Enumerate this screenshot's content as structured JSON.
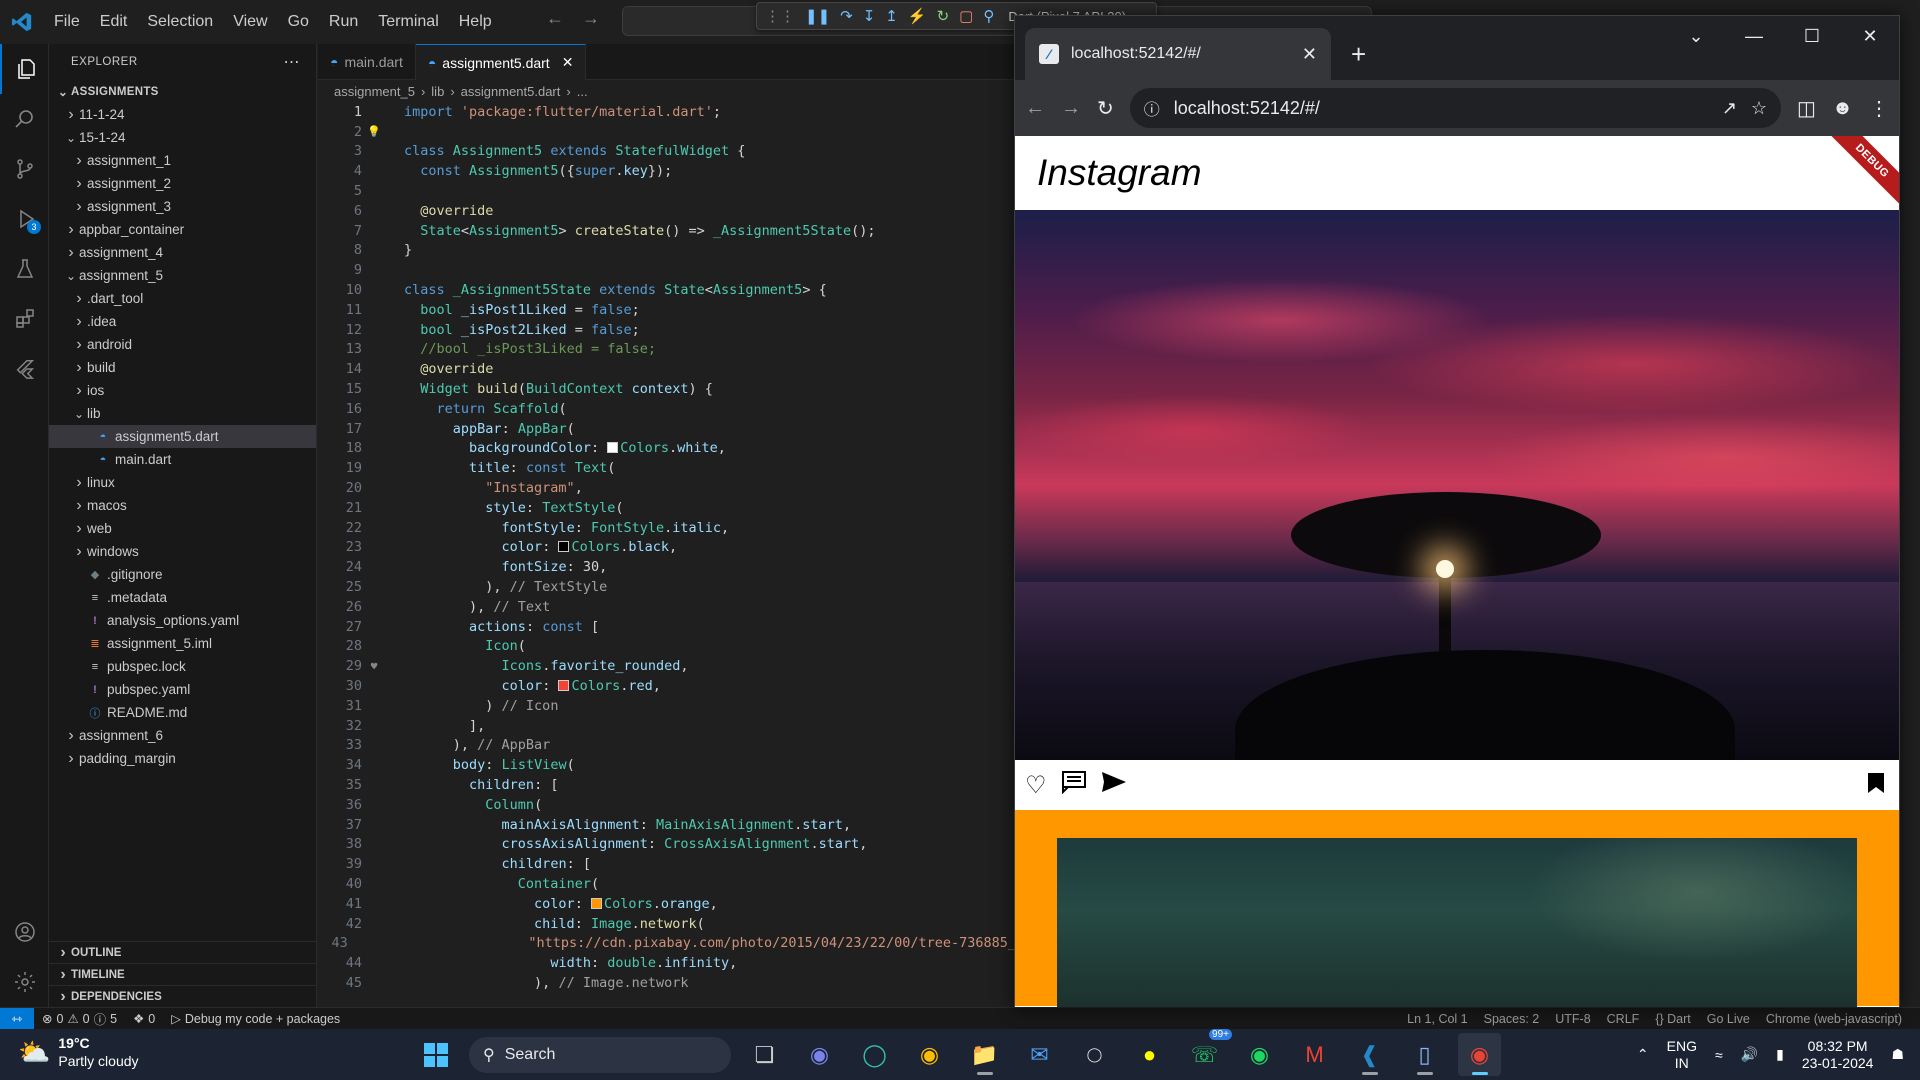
{
  "titlebar": {
    "menu": [
      "File",
      "Edit",
      "Selection",
      "View",
      "Go",
      "Run",
      "Terminal",
      "Help"
    ],
    "debug_target": "Dart (Pixel 7 API 30)"
  },
  "explorer": {
    "header": "EXPLORER",
    "root": "ASSIGNMENTS",
    "items": [
      {
        "label": "11-1-24",
        "indent": 1,
        "kind": "folder-closed"
      },
      {
        "label": "15-1-24",
        "indent": 1,
        "kind": "folder-open"
      },
      {
        "label": "assignment_1",
        "indent": 2,
        "kind": "folder-closed"
      },
      {
        "label": "assignment_2",
        "indent": 2,
        "kind": "folder-closed"
      },
      {
        "label": "assignment_3",
        "indent": 2,
        "kind": "folder-closed"
      },
      {
        "label": "appbar_container",
        "indent": 1,
        "kind": "folder-closed"
      },
      {
        "label": "assignment_4",
        "indent": 1,
        "kind": "folder-closed"
      },
      {
        "label": "assignment_5",
        "indent": 1,
        "kind": "folder-open"
      },
      {
        "label": ".dart_tool",
        "indent": 2,
        "kind": "folder-closed"
      },
      {
        "label": ".idea",
        "indent": 2,
        "kind": "folder-closed"
      },
      {
        "label": "android",
        "indent": 2,
        "kind": "folder-closed"
      },
      {
        "label": "build",
        "indent": 2,
        "kind": "folder-closed"
      },
      {
        "label": "ios",
        "indent": 2,
        "kind": "folder-closed"
      },
      {
        "label": "lib",
        "indent": 2,
        "kind": "folder-open"
      },
      {
        "label": "assignment5.dart",
        "indent": 3,
        "kind": "dart",
        "selected": true
      },
      {
        "label": "main.dart",
        "indent": 3,
        "kind": "dart"
      },
      {
        "label": "linux",
        "indent": 2,
        "kind": "folder-closed"
      },
      {
        "label": "macos",
        "indent": 2,
        "kind": "folder-closed"
      },
      {
        "label": "web",
        "indent": 2,
        "kind": "folder-closed"
      },
      {
        "label": "windows",
        "indent": 2,
        "kind": "folder-closed"
      },
      {
        "label": ".gitignore",
        "indent": 2,
        "kind": "git"
      },
      {
        "label": ".metadata",
        "indent": 2,
        "kind": "meta"
      },
      {
        "label": "analysis_options.yaml",
        "indent": 2,
        "kind": "yaml"
      },
      {
        "label": "assignment_5.iml",
        "indent": 2,
        "kind": "xml"
      },
      {
        "label": "pubspec.lock",
        "indent": 2,
        "kind": "meta"
      },
      {
        "label": "pubspec.yaml",
        "indent": 2,
        "kind": "yaml"
      },
      {
        "label": "README.md",
        "indent": 2,
        "kind": "info"
      },
      {
        "label": "assignment_6",
        "indent": 1,
        "kind": "folder-closed"
      },
      {
        "label": "padding_margin",
        "indent": 1,
        "kind": "folder-closed"
      }
    ],
    "panels": [
      "OUTLINE",
      "TIMELINE",
      "DEPENDENCIES"
    ]
  },
  "editor": {
    "tabs": [
      {
        "label": "main.dart",
        "active": false
      },
      {
        "label": "assignment5.dart",
        "active": true
      }
    ],
    "breadcrumb": [
      "assignment_5",
      "lib",
      "assignment5.dart",
      "..."
    ],
    "lines": [
      [
        [
          "kw",
          "import "
        ],
        [
          "str",
          "'package:flutter/material.dart'"
        ],
        [
          "plain",
          ";"
        ]
      ],
      [],
      [
        [
          "kw",
          "class "
        ],
        [
          "cls",
          "Assignment5 "
        ],
        [
          "kw",
          "extends "
        ],
        [
          "cls",
          "StatefulWidget "
        ],
        [
          "plain",
          "{"
        ]
      ],
      [
        [
          "plain",
          "  "
        ],
        [
          "kw",
          "const "
        ],
        [
          "cls",
          "Assignment5"
        ],
        [
          "plain",
          "({"
        ],
        [
          "kw",
          "super"
        ],
        [
          "plain",
          "."
        ],
        [
          "var",
          "key"
        ],
        [
          "plain",
          "});"
        ]
      ],
      [],
      [
        [
          "plain",
          "  "
        ],
        [
          "ann",
          "@override"
        ]
      ],
      [
        [
          "plain",
          "  "
        ],
        [
          "cls",
          "State"
        ],
        [
          "plain",
          "<"
        ],
        [
          "cls",
          "Assignment5"
        ],
        [
          "plain",
          "> "
        ],
        [
          "fn",
          "createState"
        ],
        [
          "plain",
          "() => "
        ],
        [
          "cls",
          "_Assignment5State"
        ],
        [
          "plain",
          "();"
        ]
      ],
      [
        [
          "plain",
          "}"
        ]
      ],
      [],
      [
        [
          "kw",
          "class "
        ],
        [
          "cls",
          "_Assignment5State "
        ],
        [
          "kw",
          "extends "
        ],
        [
          "cls",
          "State"
        ],
        [
          "plain",
          "<"
        ],
        [
          "cls",
          "Assignment5"
        ],
        [
          "plain",
          "> {"
        ]
      ],
      [
        [
          "plain",
          "  "
        ],
        [
          "cls",
          "bool "
        ],
        [
          "var",
          "_isPost1Liked "
        ],
        [
          "plain",
          "= "
        ],
        [
          "kw",
          "false"
        ],
        [
          "plain",
          ";"
        ]
      ],
      [
        [
          "plain",
          "  "
        ],
        [
          "cls",
          "bool "
        ],
        [
          "var",
          "_isPost2Liked "
        ],
        [
          "plain",
          "= "
        ],
        [
          "kw",
          "false"
        ],
        [
          "plain",
          ";"
        ]
      ],
      [
        [
          "plain",
          "  "
        ],
        [
          "cmt",
          "//bool _isPost3Liked = false;"
        ]
      ],
      [
        [
          "plain",
          "  "
        ],
        [
          "ann",
          "@override"
        ]
      ],
      [
        [
          "plain",
          "  "
        ],
        [
          "cls",
          "Widget "
        ],
        [
          "fn",
          "build"
        ],
        [
          "plain",
          "("
        ],
        [
          "cls",
          "BuildContext "
        ],
        [
          "var",
          "context"
        ],
        [
          "plain",
          ") {"
        ]
      ],
      [
        [
          "plain",
          "    "
        ],
        [
          "kw",
          "return "
        ],
        [
          "cls",
          "Scaffold"
        ],
        [
          "plain",
          "("
        ]
      ],
      [
        [
          "plain",
          "      "
        ],
        [
          "var",
          "appBar"
        ],
        [
          "plain",
          ": "
        ],
        [
          "cls",
          "AppBar"
        ],
        [
          "plain",
          "("
        ]
      ],
      [
        [
          "plain",
          "        "
        ],
        [
          "var",
          "backgroundColor"
        ],
        [
          "plain",
          ": "
        ],
        [
          "swatch",
          "#ffffff"
        ],
        [
          "cls",
          "Colors"
        ],
        [
          "plain",
          "."
        ],
        [
          "var",
          "white"
        ],
        [
          "plain",
          ","
        ]
      ],
      [
        [
          "plain",
          "        "
        ],
        [
          "var",
          "title"
        ],
        [
          "plain",
          ": "
        ],
        [
          "kw",
          "const "
        ],
        [
          "cls",
          "Text"
        ],
        [
          "plain",
          "("
        ]
      ],
      [
        [
          "plain",
          "          "
        ],
        [
          "str",
          "\"Instagram\""
        ],
        [
          "plain",
          ","
        ]
      ],
      [
        [
          "plain",
          "          "
        ],
        [
          "var",
          "style"
        ],
        [
          "plain",
          ": "
        ],
        [
          "cls",
          "TextStyle"
        ],
        [
          "plain",
          "("
        ]
      ],
      [
        [
          "plain",
          "            "
        ],
        [
          "var",
          "fontStyle"
        ],
        [
          "plain",
          ": "
        ],
        [
          "cls",
          "FontStyle"
        ],
        [
          "plain",
          "."
        ],
        [
          "var",
          "italic"
        ],
        [
          "plain",
          ","
        ]
      ],
      [
        [
          "plain",
          "            "
        ],
        [
          "var",
          "color"
        ],
        [
          "plain",
          ": "
        ],
        [
          "swatch",
          "#000000"
        ],
        [
          "cls",
          "Colors"
        ],
        [
          "plain",
          "."
        ],
        [
          "var",
          "black"
        ],
        [
          "plain",
          ","
        ]
      ],
      [
        [
          "plain",
          "            "
        ],
        [
          "var",
          "fontSize"
        ],
        [
          "plain",
          ": "
        ],
        [
          "plain",
          "30,"
        ]
      ],
      [
        [
          "plain",
          "          ), "
        ],
        [
          "cmt-grey",
          "// TextStyle"
        ]
      ],
      [
        [
          "plain",
          "        ), "
        ],
        [
          "cmt-grey",
          "// Text"
        ]
      ],
      [
        [
          "plain",
          "        "
        ],
        [
          "var",
          "actions"
        ],
        [
          "plain",
          ": "
        ],
        [
          "kw",
          "const "
        ],
        [
          "plain",
          "["
        ]
      ],
      [
        [
          "plain",
          "          "
        ],
        [
          "cls",
          "Icon"
        ],
        [
          "plain",
          "("
        ]
      ],
      [
        [
          "plain",
          "            "
        ],
        [
          "cls",
          "Icons"
        ],
        [
          "plain",
          "."
        ],
        [
          "var",
          "favorite_rounded"
        ],
        [
          "plain",
          ","
        ]
      ],
      [
        [
          "plain",
          "            "
        ],
        [
          "var",
          "color"
        ],
        [
          "plain",
          ": "
        ],
        [
          "swatch",
          "#f44336"
        ],
        [
          "cls",
          "Colors"
        ],
        [
          "plain",
          "."
        ],
        [
          "var",
          "red"
        ],
        [
          "plain",
          ","
        ]
      ],
      [
        [
          "plain",
          "          ) "
        ],
        [
          "cmt-grey",
          "// Icon"
        ]
      ],
      [
        [
          "plain",
          "        ],"
        ]
      ],
      [
        [
          "plain",
          "      ), "
        ],
        [
          "cmt-grey",
          "// AppBar"
        ]
      ],
      [
        [
          "plain",
          "      "
        ],
        [
          "var",
          "body"
        ],
        [
          "plain",
          ": "
        ],
        [
          "cls",
          "ListView"
        ],
        [
          "plain",
          "("
        ]
      ],
      [
        [
          "plain",
          "        "
        ],
        [
          "var",
          "children"
        ],
        [
          "plain",
          ": ["
        ]
      ],
      [
        [
          "plain",
          "          "
        ],
        [
          "cls",
          "Column"
        ],
        [
          "plain",
          "("
        ]
      ],
      [
        [
          "plain",
          "            "
        ],
        [
          "var",
          "mainAxisAlignment"
        ],
        [
          "plain",
          ": "
        ],
        [
          "cls",
          "MainAxisAlignment"
        ],
        [
          "plain",
          "."
        ],
        [
          "var",
          "start"
        ],
        [
          "plain",
          ","
        ]
      ],
      [
        [
          "plain",
          "            "
        ],
        [
          "var",
          "crossAxisAlignment"
        ],
        [
          "plain",
          ": "
        ],
        [
          "cls",
          "CrossAxisAlignment"
        ],
        [
          "plain",
          "."
        ],
        [
          "var",
          "start"
        ],
        [
          "plain",
          ","
        ]
      ],
      [
        [
          "plain",
          "            "
        ],
        [
          "var",
          "children"
        ],
        [
          "plain",
          ": ["
        ]
      ],
      [
        [
          "plain",
          "              "
        ],
        [
          "cls",
          "Container"
        ],
        [
          "plain",
          "("
        ]
      ],
      [
        [
          "plain",
          "                "
        ],
        [
          "var",
          "color"
        ],
        [
          "plain",
          ": "
        ],
        [
          "swatch",
          "#ff9800"
        ],
        [
          "cls",
          "Colors"
        ],
        [
          "plain",
          "."
        ],
        [
          "var",
          "orange"
        ],
        [
          "plain",
          ","
        ]
      ],
      [
        [
          "plain",
          "                "
        ],
        [
          "var",
          "child"
        ],
        [
          "plain",
          ": "
        ],
        [
          "cls",
          "Image"
        ],
        [
          "plain",
          "."
        ],
        [
          "fn",
          "network"
        ],
        [
          "plain",
          "("
        ]
      ],
      [
        [
          "plain",
          "                  "
        ],
        [
          "str",
          "\"https://cdn.pixabay.com/photo/2015/04/23/22/00/tree-736885_"
        ]
      ],
      [
        [
          "plain",
          "                  "
        ],
        [
          "var",
          "width"
        ],
        [
          "plain",
          ": "
        ],
        [
          "cls",
          "double"
        ],
        [
          "plain",
          "."
        ],
        [
          "var",
          "infinity"
        ],
        [
          "plain",
          ","
        ]
      ],
      [
        [
          "plain",
          "                ), "
        ],
        [
          "cmt-grey",
          "// Image.network"
        ]
      ]
    ]
  },
  "statusbar": {
    "errors": "0",
    "warnings": "0",
    "infos": "5",
    "ports": "0",
    "debug_label": "Debug my code + packages",
    "right": [
      "Ln 1, Col 1",
      "Spaces: 2",
      "UTF-8",
      "CRLF",
      "{} Dart",
      "Go Live",
      "Chrome (web-javascript)"
    ]
  },
  "browser": {
    "tab_title": "localhost:52142/#/",
    "url": "localhost:52142/#/",
    "app": {
      "title": "Instagram",
      "debug_banner": "DEBUG"
    }
  },
  "taskbar": {
    "temperature": "19°C",
    "weather": "Partly cloudy",
    "search_label": "Search",
    "whatsapp_badge": "99+",
    "lang_line1": "ENG",
    "lang_line2": "IN",
    "time": "08:32 PM",
    "date": "23-01-2024"
  }
}
